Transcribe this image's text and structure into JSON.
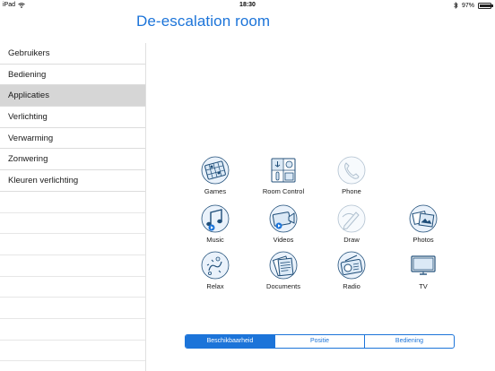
{
  "status_bar": {
    "device": "iPad",
    "time": "18:30",
    "battery": "97%",
    "battery_level": 0.97
  },
  "title": "De-escalation room",
  "sidebar": {
    "items": [
      {
        "label": "Gebruikers",
        "active": false
      },
      {
        "label": "Bediening",
        "active": false
      },
      {
        "label": "Applicaties",
        "active": true
      },
      {
        "label": "Verlichting",
        "active": false
      },
      {
        "label": "Verwarming",
        "active": false
      },
      {
        "label": "Zonwering",
        "active": false
      },
      {
        "label": "Kleuren verlichting",
        "active": false
      }
    ]
  },
  "apps": [
    {
      "label": "Games",
      "icon": "games-icon",
      "enabled": true
    },
    {
      "label": "Room Control",
      "icon": "room-control-icon",
      "enabled": true
    },
    {
      "label": "Phone",
      "icon": "phone-icon",
      "enabled": false
    },
    {
      "label": "Music",
      "icon": "music-icon",
      "enabled": true
    },
    {
      "label": "Videos",
      "icon": "videos-icon",
      "enabled": true
    },
    {
      "label": "Draw",
      "icon": "draw-icon",
      "enabled": false
    },
    {
      "label": "Photos",
      "icon": "photos-icon",
      "enabled": true
    },
    {
      "label": "Relax",
      "icon": "relax-icon",
      "enabled": true
    },
    {
      "label": "Documents",
      "icon": "documents-icon",
      "enabled": true
    },
    {
      "label": "Radio",
      "icon": "radio-icon",
      "enabled": true
    },
    {
      "label": "TV",
      "icon": "tv-icon",
      "enabled": true
    }
  ],
  "segmented": {
    "options": [
      "Beschikbaarheid",
      "Positie",
      "Bediening"
    ],
    "selected": 0
  },
  "colors": {
    "accent": "#1c74d9",
    "icon_stroke": "#1f4e79",
    "icon_fill": "#dbe9f6",
    "selected_row": "#d6d6d6"
  }
}
